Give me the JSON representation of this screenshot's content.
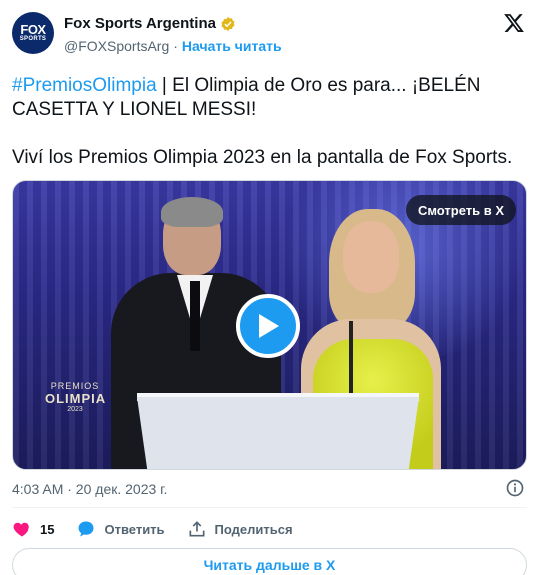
{
  "header": {
    "display_name": "Fox Sports Argentina",
    "handle": "@FOXSportsArg",
    "separator": "·",
    "follow_label": "Начать читать",
    "avatar_top": "FOX",
    "avatar_bottom": "SPORTS"
  },
  "tweet": {
    "hashtag": "#PremiosOlimpia",
    "line1_rest": " | El Olimpia de Oro es para... ¡BELÉN CASETTA Y LIONEL MESSI!",
    "line2": "Viví los Premios Olimpia 2023 en la pantalla de Fox Sports."
  },
  "media": {
    "watch_label": "Смотреть в X",
    "logo_small": "PREMIOS",
    "logo_big": "OLIMPIA",
    "logo_year": "2023"
  },
  "meta": {
    "timestamp": "4:03 AM · 20 дек. 2023 г."
  },
  "actions": {
    "likes_count": "15",
    "reply_label": "Ответить",
    "share_label": "Поделиться"
  },
  "footer": {
    "read_more_label": "Читать дальше в X"
  },
  "colors": {
    "accent": "#1d9bf0",
    "like": "#f91880",
    "text": "#0f1419",
    "muted": "#536471"
  }
}
